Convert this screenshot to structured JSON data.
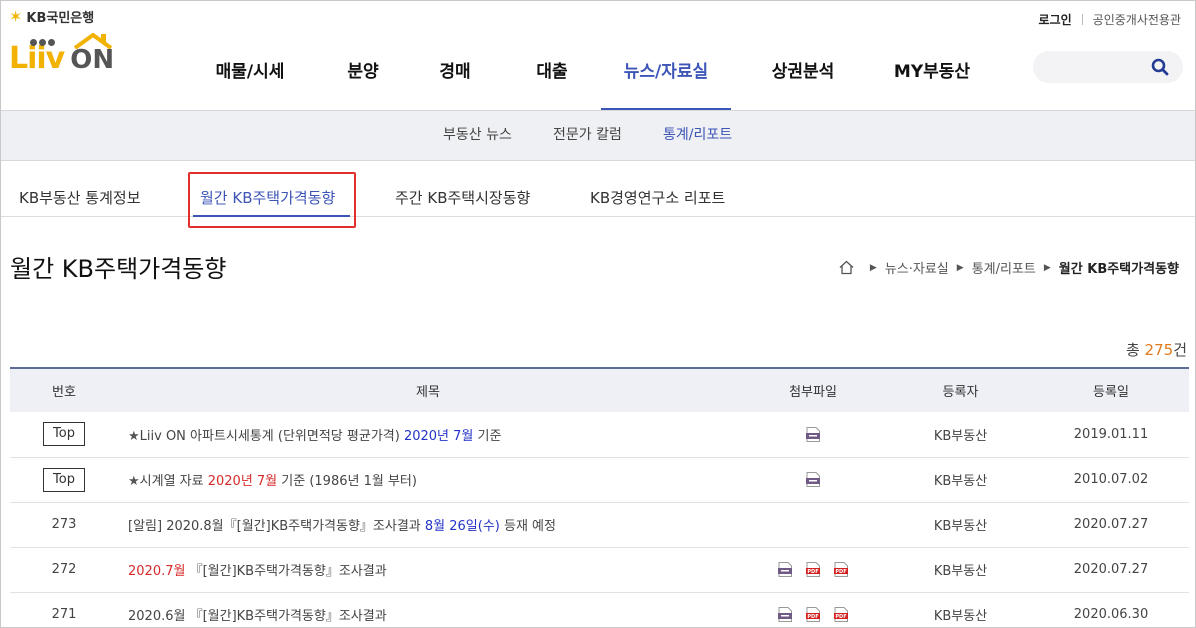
{
  "kb_brand": {
    "label": "KB국민은행"
  },
  "utility": {
    "login": "로그인",
    "agent_center": "공인중개사전용관"
  },
  "brand": {
    "liiv": "Liiv",
    "on": "ON"
  },
  "gnb": [
    {
      "label": "매물/시세"
    },
    {
      "label": "분양"
    },
    {
      "label": "경매"
    },
    {
      "label": "대출"
    },
    {
      "label": "뉴스/자료실",
      "active": true
    },
    {
      "label": "상권분석"
    },
    {
      "label": "MY부동산"
    }
  ],
  "search": {
    "placeholder": ""
  },
  "subnav": [
    {
      "label": "부동산 뉴스"
    },
    {
      "label": "전문가 칼럼"
    },
    {
      "label": "통계/리포트",
      "active": true
    }
  ],
  "tabs": [
    {
      "label": "KB부동산 통계정보"
    },
    {
      "label": "월간 KB주택가격동향",
      "active": true
    },
    {
      "label": "주간 KB주택시장동향"
    },
    {
      "label": "KB경영연구소 리포트"
    }
  ],
  "page": {
    "title": "월간 KB주택가격동향"
  },
  "breadcrumb": [
    "뉴스·자료실",
    "통계/리포트",
    "월간 KB주택가격동향"
  ],
  "total": {
    "prefix": "총 ",
    "count": "275",
    "suffix": "건"
  },
  "table": {
    "headers": [
      "번호",
      "제목",
      "첨부파일",
      "등록자",
      "등록일"
    ],
    "rows": [
      {
        "no": "Top",
        "is_top": true,
        "title_parts": [
          {
            "t": "★",
            "c": "star"
          },
          {
            "t": "Liiv ON 아파트시세통계 (단위면적당 평균가격) "
          },
          {
            "t": "2020년 7월",
            "c": "blue"
          },
          {
            "t": " 기준"
          }
        ],
        "files": [
          "hwp"
        ],
        "author": "KB부동산",
        "date": "2019.01.11"
      },
      {
        "no": "Top",
        "is_top": true,
        "title_parts": [
          {
            "t": "★",
            "c": "star"
          },
          {
            "t": "시계열 자료 "
          },
          {
            "t": "2020년 7월",
            "c": "red"
          },
          {
            "t": " 기준 (1986년 1월 부터)"
          }
        ],
        "files": [
          "hwp"
        ],
        "author": "KB부동산",
        "date": "2010.07.02"
      },
      {
        "no": "273",
        "is_top": false,
        "title_parts": [
          {
            "t": "[알림] 2020.8월『[월간]KB주택가격동향』조사결과 "
          },
          {
            "t": "8월 26일(수)",
            "c": "blue"
          },
          {
            "t": " 등재 예정"
          }
        ],
        "files": [],
        "author": "KB부동산",
        "date": "2020.07.27"
      },
      {
        "no": "272",
        "is_top": false,
        "title_parts": [
          {
            "t": "2020.7월",
            "c": "red"
          },
          {
            "t": " 『[월간]KB주택가격동향』조사결과"
          }
        ],
        "files": [
          "hwp",
          "pdf",
          "pdf"
        ],
        "author": "KB부동산",
        "date": "2020.07.27"
      },
      {
        "no": "271",
        "is_top": false,
        "title_parts": [
          {
            "t": "2020.6월 『[월간]KB주택가격동향』조사결과"
          }
        ],
        "files": [
          "hwp",
          "pdf",
          "pdf"
        ],
        "author": "KB부동산",
        "date": "2020.06.30"
      }
    ]
  }
}
